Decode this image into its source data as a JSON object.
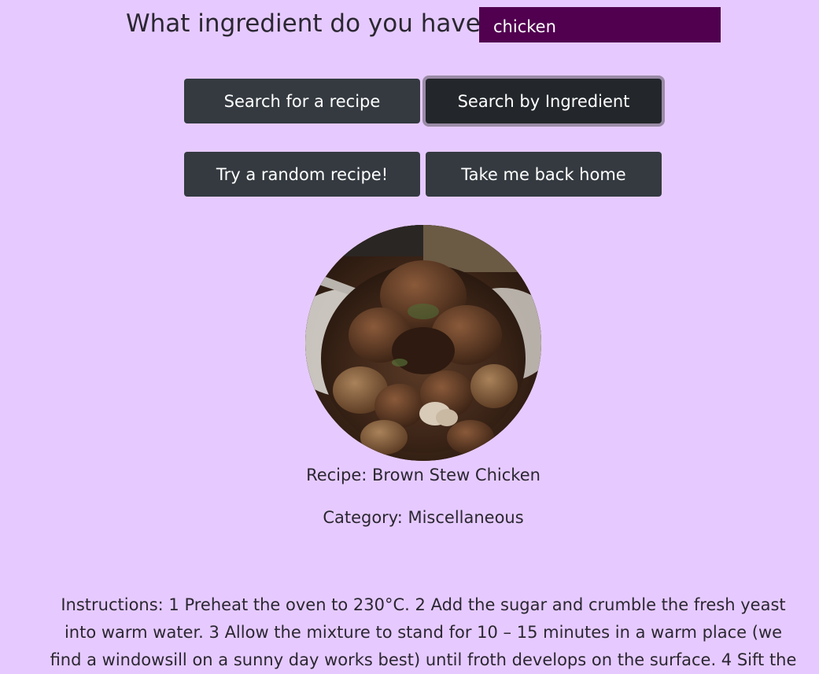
{
  "search": {
    "label": "What ingredient do you have?",
    "value": "chicken"
  },
  "buttons": {
    "search_recipe": "Search for a recipe",
    "search_ingredient": "Search by Ingredient",
    "random_recipe": "Try a random recipe!",
    "back_home": "Take me back home"
  },
  "active_button": "search_ingredient",
  "recipe": {
    "name": "Recipe: Brown Stew Chicken",
    "category": "Category: Miscellaneous",
    "instructions": "Instructions: 1 Preheat the oven to 230°C. 2 Add the sugar and crumble the fresh yeast into warm water. 3 Allow the mixture to stand for 10 – 15 minutes in a warm place (we find a windowsill on a sunny day works best) until froth develops on the surface. 4 Sift the"
  },
  "colors": {
    "background": "#e6caff",
    "input_background": "#510050",
    "button": "#343a40",
    "button_active": "#23272b"
  }
}
